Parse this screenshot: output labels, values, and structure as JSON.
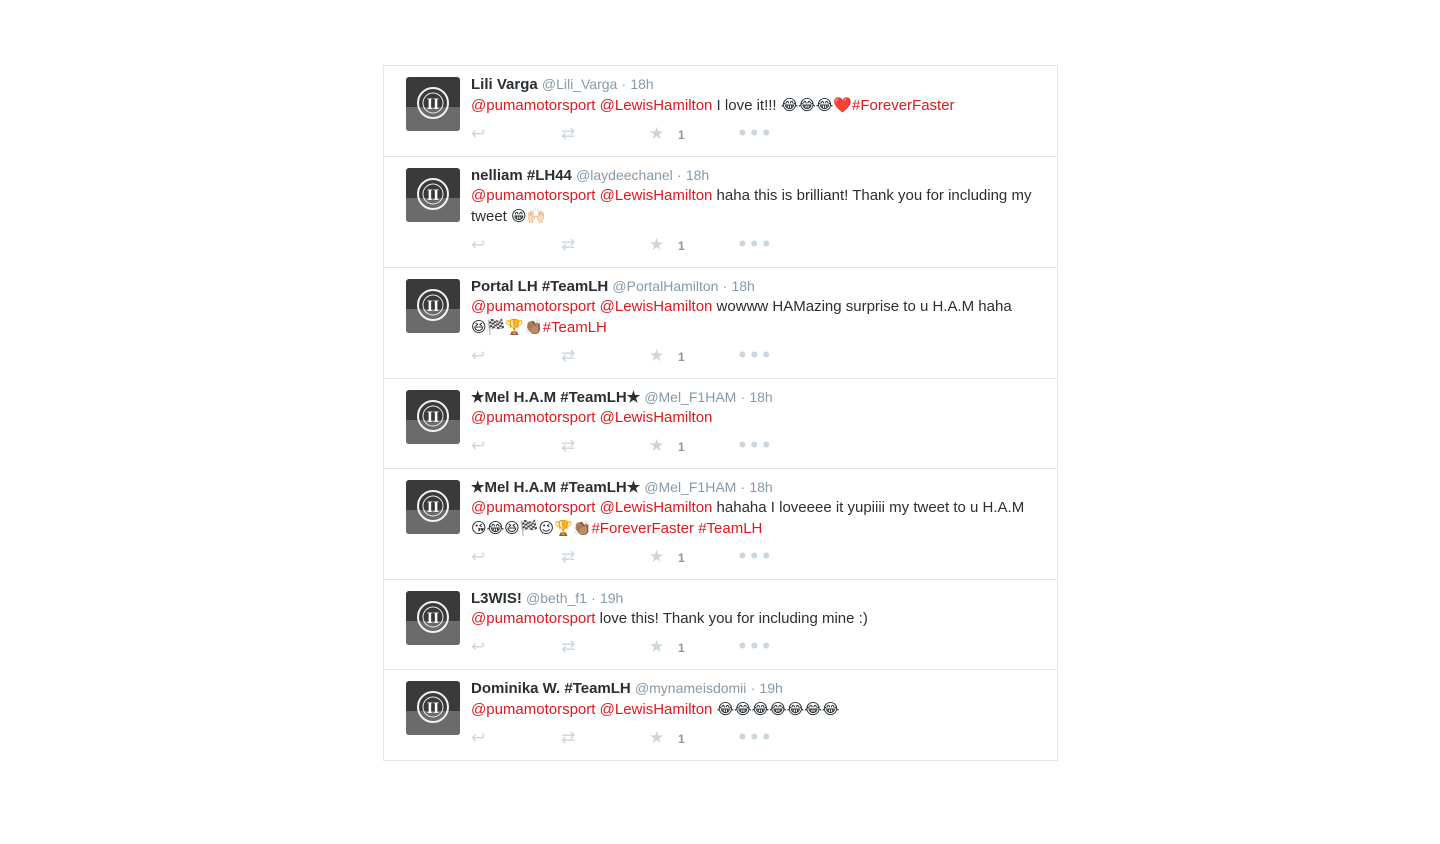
{
  "accent_color": "#e0191d",
  "tweets": [
    {
      "name": "Lili Varga",
      "handle": "@Lili_Varga",
      "time": "18h",
      "segments": [
        {
          "type": "mention",
          "text": "@pumamotorsport"
        },
        {
          "type": "text",
          "text": " "
        },
        {
          "type": "mention",
          "text": "@LewisHamilton"
        },
        {
          "type": "text",
          "text": " I love it!!! "
        },
        {
          "type": "emoji",
          "text": "😂😂😂❤️ "
        },
        {
          "type": "hashtag",
          "text": "#ForeverFaster"
        }
      ],
      "favorites": "1"
    },
    {
      "name": "nelliam        #LH44",
      "handle": "@laydeechanel",
      "time": "18h",
      "segments": [
        {
          "type": "mention",
          "text": "@pumamotorsport"
        },
        {
          "type": "text",
          "text": " "
        },
        {
          "type": "mention",
          "text": "@LewisHamilton"
        },
        {
          "type": "text",
          "text": " haha this is brilliant! Thank you for including my tweet "
        },
        {
          "type": "emoji",
          "text": "😁🙌🏻"
        }
      ],
      "favorites": "1"
    },
    {
      "name": "Portal LH #TeamLH",
      "handle": "@PortalHamilton",
      "time": "18h",
      "segments": [
        {
          "type": "mention",
          "text": "@pumamotorsport"
        },
        {
          "type": "text",
          "text": " "
        },
        {
          "type": "mention",
          "text": "@LewisHamilton"
        },
        {
          "type": "text",
          "text": " wowww HAMazing surprise to u H.A.M haha "
        },
        {
          "type": "emoji",
          "text": "😆🏁🏆👏🏽 "
        },
        {
          "type": "hashtag",
          "text": "#TeamLH"
        }
      ],
      "favorites": "1"
    },
    {
      "name": "★Mel H.A.M #TeamLH★",
      "handle": "@Mel_F1HAM",
      "time": "18h",
      "segments": [
        {
          "type": "mention",
          "text": "@pumamotorsport"
        },
        {
          "type": "text",
          "text": " "
        },
        {
          "type": "mention",
          "text": "@LewisHamilton"
        }
      ],
      "favorites": "1"
    },
    {
      "name": "★Mel H.A.M #TeamLH★",
      "handle": "@Mel_F1HAM",
      "time": "18h",
      "segments": [
        {
          "type": "mention",
          "text": "@pumamotorsport"
        },
        {
          "type": "text",
          "text": " "
        },
        {
          "type": "mention",
          "text": "@LewisHamilton"
        },
        {
          "type": "text",
          "text": "  hahaha I loveeee it yupiiii my tweet to u H.A.M "
        },
        {
          "type": "emoji",
          "text": "😘😂😆🏁😉🏆👏🏽 "
        },
        {
          "type": "hashtag",
          "text": "#ForeverFaster"
        },
        {
          "type": "text",
          "text": " "
        },
        {
          "type": "hashtag",
          "text": "#TeamLH"
        }
      ],
      "favorites": "1"
    },
    {
      "name": "L3WIS!",
      "handle": "@beth_f1",
      "time": "19h",
      "segments": [
        {
          "type": "mention",
          "text": "@pumamotorsport"
        },
        {
          "type": "text",
          "text": " love this! Thank you for including mine :)"
        }
      ],
      "favorites": "1"
    },
    {
      "name": "Dominika W. #TeamLH",
      "handle": "@mynameisdomii",
      "time": "19h",
      "segments": [
        {
          "type": "mention",
          "text": "@pumamotorsport"
        },
        {
          "type": "text",
          "text": " "
        },
        {
          "type": "mention",
          "text": "@LewisHamilton"
        },
        {
          "type": "text",
          "text": " "
        },
        {
          "type": "emoji",
          "text": "😂😂😂😂😂😂😂"
        }
      ],
      "favorites": "1"
    }
  ],
  "icons": {
    "reply": "reply-icon",
    "retweet": "retweet-icon",
    "favorite": "star-icon",
    "more": "more-icon"
  }
}
